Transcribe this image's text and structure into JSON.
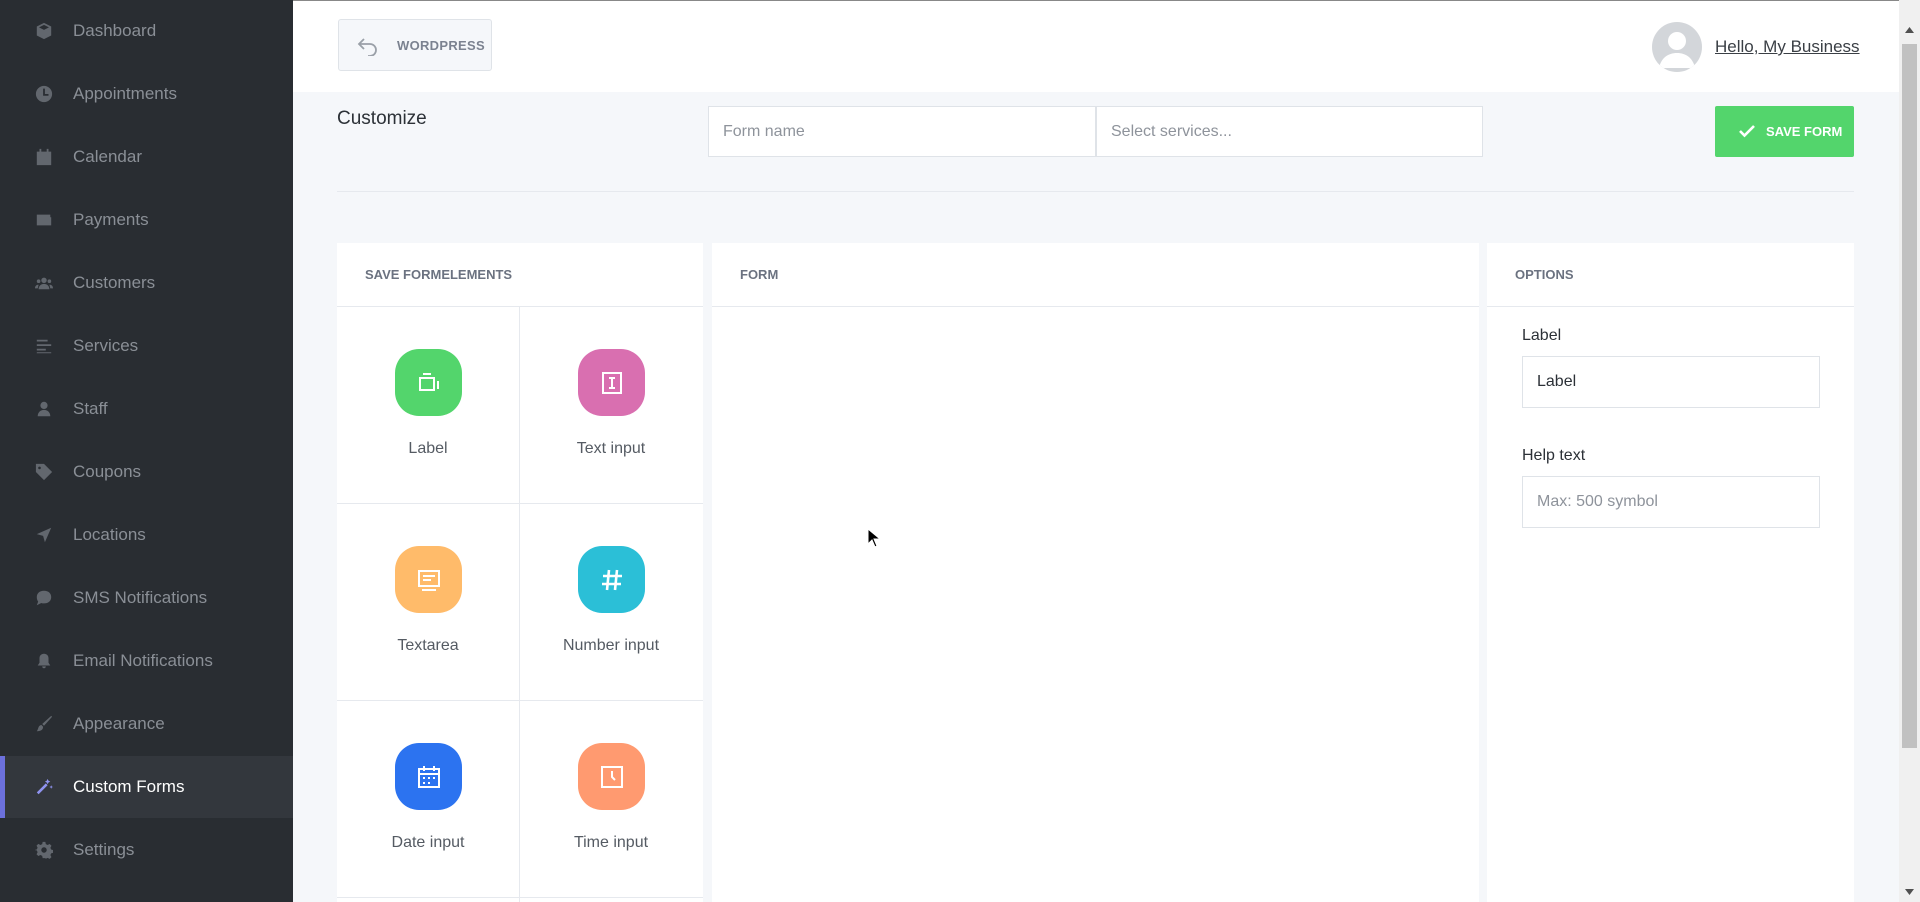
{
  "sidebar": {
    "items": [
      {
        "label": "Dashboard",
        "icon": "cube-icon"
      },
      {
        "label": "Appointments",
        "icon": "clock-icon"
      },
      {
        "label": "Calendar",
        "icon": "calendar-check-icon"
      },
      {
        "label": "Payments",
        "icon": "wallet-icon"
      },
      {
        "label": "Customers",
        "icon": "users-icon"
      },
      {
        "label": "Services",
        "icon": "list-icon"
      },
      {
        "label": "Staff",
        "icon": "user-icon"
      },
      {
        "label": "Coupons",
        "icon": "tag-icon"
      },
      {
        "label": "Locations",
        "icon": "location-arrow-icon"
      },
      {
        "label": "SMS Notifications",
        "icon": "comment-icon"
      },
      {
        "label": "Email Notifications",
        "icon": "bell-icon"
      },
      {
        "label": "Appearance",
        "icon": "brush-icon"
      },
      {
        "label": "Custom Forms",
        "icon": "magic-wand-icon"
      },
      {
        "label": "Settings",
        "icon": "gear-icon"
      }
    ],
    "active": "Custom Forms"
  },
  "header": {
    "wordpress_label": "WORDPRESS",
    "greeting": "Hello, My Business"
  },
  "customize": {
    "title": "Customize",
    "form_name_placeholder": "Form name",
    "services_placeholder": "Select services...",
    "save_label": "SAVE FORM"
  },
  "elements_panel": {
    "title": "SAVE FORMELEMENTS",
    "items": [
      {
        "label": "Label",
        "color": "#53d56c"
      },
      {
        "label": "Text input",
        "color": "#d96fb0"
      },
      {
        "label": "Textarea",
        "color": "#ffbb6a"
      },
      {
        "label": "Number input",
        "color": "#2bbfd7"
      },
      {
        "label": "Date input",
        "color": "#2c73f0"
      },
      {
        "label": "Time input",
        "color": "#ff9a70"
      }
    ]
  },
  "form_panel": {
    "title": "FORM"
  },
  "options_panel": {
    "title": "OPTIONS",
    "label_caption": "Label",
    "label_value": "Label",
    "help_caption": "Help text",
    "help_placeholder": "Max: 500 symbol"
  },
  "colors": {
    "sidebar_bg": "#292d32",
    "accent": "#6c70dc",
    "save_green": "#53d56c"
  }
}
